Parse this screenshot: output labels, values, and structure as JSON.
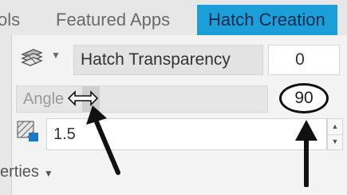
{
  "tabs": {
    "tools": "ols",
    "featured": "Featured Apps",
    "hatch": "Hatch Creation"
  },
  "properties": {
    "transparency_label": "Hatch Transparency",
    "transparency_value": "0",
    "angle_label": "Angle",
    "angle_value": "90",
    "scale_value": "1.5",
    "panel_title": "erties"
  },
  "colors": {
    "active_tab": "#1c9fd9",
    "annotation": "#111111"
  },
  "icons": [
    "transparency-icon",
    "dropdown-caret-icon",
    "resize-cursor-icon",
    "hatch-scale-icon",
    "spinner-up-icon",
    "spinner-down-icon",
    "panel-caret-icon",
    "annotation-arrow"
  ]
}
